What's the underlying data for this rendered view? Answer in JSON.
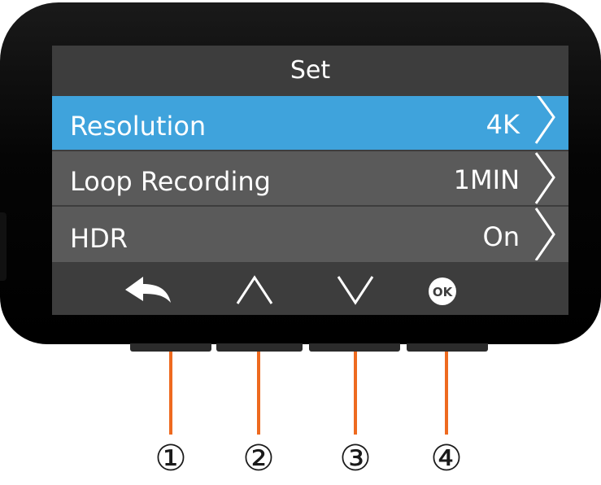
{
  "screen": {
    "title": "Set",
    "rows": [
      {
        "label": "Resolution",
        "value": "4K",
        "selected": true
      },
      {
        "label": "Loop Recording",
        "value": "1MIN",
        "selected": false
      },
      {
        "label": "HDR",
        "value": "On",
        "selected": false
      }
    ],
    "nav": {
      "back_icon": "back-arrow-icon",
      "up_icon": "chevron-up-icon",
      "down_icon": "chevron-down-icon",
      "ok_label": "OK"
    }
  },
  "buttons": [
    {
      "number": "①"
    },
    {
      "number": "②"
    },
    {
      "number": "③"
    },
    {
      "number": "④"
    }
  ],
  "colors": {
    "selected_row": "#3fa3dc",
    "row": "#5a5a5a",
    "screen_bg": "#3d3d3d",
    "callout_line": "#ee6a1f",
    "device_body": "#0a0a0a"
  }
}
